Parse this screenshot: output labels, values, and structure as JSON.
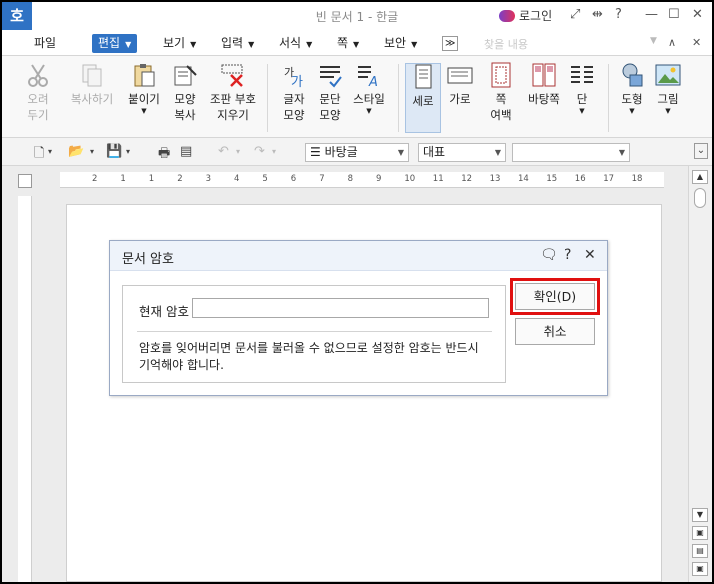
{
  "app": {
    "logo": "호",
    "title": "빈 문서 1 - 한글"
  },
  "titlebar": {
    "login": "로그인",
    "icons": [
      "expand-icon",
      "split-icon",
      "help-icon",
      "minimize-icon",
      "maximize-icon",
      "close-icon"
    ],
    "help": "?",
    "minimize": "—",
    "maximize": "☐",
    "close": "✕"
  },
  "menus": [
    {
      "label": "파일"
    },
    {
      "label": "편집"
    },
    {
      "label": "보기"
    },
    {
      "label": "입력"
    },
    {
      "label": "서식"
    },
    {
      "label": "쪽"
    },
    {
      "label": "보안"
    }
  ],
  "menubar": {
    "overflow": "≫",
    "search_placeholder": "찾을 내용",
    "collapse": "∧",
    "close": "✕"
  },
  "ribbon": {
    "cut": {
      "line1": "오려",
      "line2": "두기"
    },
    "copy": {
      "line1": "복사하기",
      "line2": ""
    },
    "paste": {
      "line1": "붙이기"
    },
    "format_copy": {
      "line1": "모양",
      "line2": "복사"
    },
    "erase_marks": {
      "line1": "조판 부호",
      "line2": "지우기"
    },
    "char_shape": {
      "line1": "글자",
      "line2": "모양"
    },
    "para_shape": {
      "line1": "문단",
      "line2": "모양"
    },
    "style": {
      "line1": "스타일"
    },
    "portrait": {
      "line1": "세로"
    },
    "landscape": {
      "line1": "가로"
    },
    "page_margin": {
      "line1": "쪽",
      "line2": "여백"
    },
    "background_page": {
      "line1": "바탕쪽"
    },
    "columns": {
      "line1": "단"
    },
    "shapes": {
      "line1": "도형"
    },
    "picture": {
      "line1": "그림"
    }
  },
  "toolbar": {
    "font_style": "바탕글",
    "font_face": "대표",
    "font_name": "",
    "expand": "⌄"
  },
  "ruler": {
    "labels": [
      "2",
      "1",
      "1",
      "2",
      "3",
      "4",
      "5",
      "6",
      "7",
      "8",
      "9",
      "10",
      "11",
      "12",
      "13",
      "14",
      "15",
      "16",
      "17",
      "18"
    ]
  },
  "dialog": {
    "title": "문서 암호",
    "help": "?",
    "close": "✕",
    "password_label": "현재 암호",
    "password_value": "",
    "note": "암호를 잊어버리면 문서를 불러올 수 없으므로 설정한 암호는 반드시 기억해야 합니다.",
    "ok_label": "확인(D)",
    "cancel_label": "취소"
  },
  "colors": {
    "accent": "#2f72c4",
    "highlight": "#e01010",
    "dialog_header": "#eef3fa"
  }
}
